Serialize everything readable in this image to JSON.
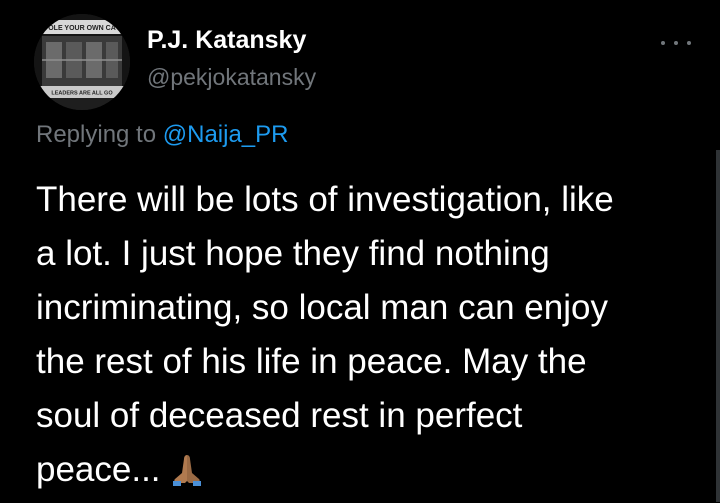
{
  "author": {
    "display_name": "P.J. Katansky",
    "handle": "@pekjokatansky",
    "avatar_text_top": "OLE  YOUR OWN CA",
    "avatar_text_bottom": "LEADERS   ARE ALL GO"
  },
  "reply": {
    "prefix": "Replying to",
    "mention": "@Naija_PR"
  },
  "tweet": {
    "lines": [
      "There will be lots of investigation, like",
      "a lot. I just hope they find nothing",
      "incriminating, so local man can enjoy",
      "the rest of his life in peace. May the",
      "soul of deceased rest in perfect",
      "peace..."
    ],
    "emoji": "folded-hands-icon"
  },
  "colors": {
    "background": "#000000",
    "text": "#ffffff",
    "secondary": "#71767b",
    "link": "#1d9bf0"
  }
}
